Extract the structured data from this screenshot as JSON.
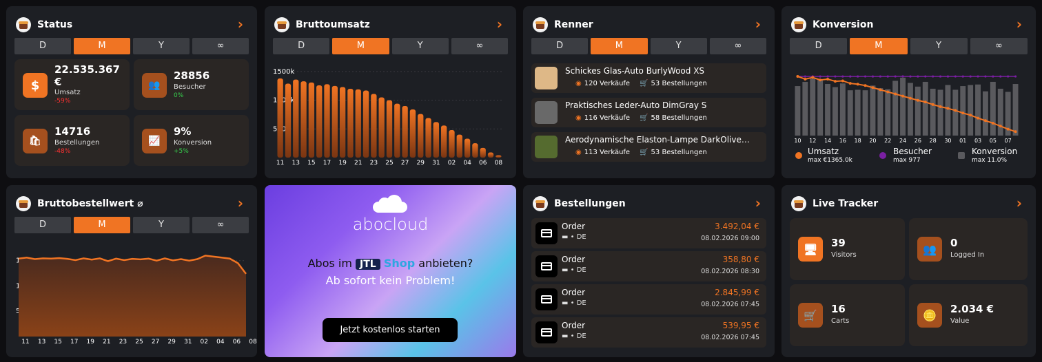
{
  "segments": [
    "D",
    "M",
    "Y",
    "∞"
  ],
  "accent": "#f07423",
  "status": {
    "title": "Status",
    "tiles": [
      {
        "icon": "dollar-icon",
        "glyph": "$",
        "value": "22.535.367",
        "value2": "€",
        "label": "Umsatz",
        "change": "-59%",
        "trend": "neg"
      },
      {
        "icon": "users-icon",
        "glyph": "👥",
        "value": "28856",
        "label": "Besucher",
        "change": "0%",
        "trend": "pos"
      },
      {
        "icon": "bag-icon",
        "glyph": "🛍",
        "value": "14716",
        "label": "Bestellungen",
        "change": "-48%",
        "trend": "neg"
      },
      {
        "icon": "conversion-icon",
        "glyph": "📈",
        "value": "9%",
        "label": "Konversion",
        "change": "+5%",
        "trend": "pos"
      }
    ]
  },
  "brutto": {
    "title": "Bruttoumsatz",
    "chart_data": {
      "type": "bar",
      "categories": [
        "11",
        "12",
        "13",
        "14",
        "15",
        "16",
        "17",
        "18",
        "19",
        "20",
        "21",
        "22",
        "23",
        "24",
        "25",
        "26",
        "27",
        "28",
        "29",
        "30",
        "31",
        "01",
        "02",
        "03",
        "04",
        "05",
        "06",
        "07",
        "08"
      ],
      "values": [
        1380,
        1290,
        1360,
        1330,
        1310,
        1260,
        1280,
        1250,
        1230,
        1200,
        1190,
        1170,
        1110,
        1050,
        1000,
        940,
        900,
        840,
        760,
        690,
        620,
        560,
        480,
        400,
        330,
        250,
        170,
        90,
        40
      ],
      "x_tick_labels": [
        "11",
        "13",
        "15",
        "17",
        "19",
        "21",
        "23",
        "25",
        "27",
        "29",
        "31",
        "02",
        "04",
        "06",
        "08"
      ],
      "y_tick_labels": [
        "500k",
        "1000k",
        "1500k"
      ],
      "ylim": [
        0,
        1500
      ]
    }
  },
  "renner": {
    "title": "Renner",
    "items": [
      {
        "name": "Schickes Glas-Auto BurlyWood XS",
        "sales": "120 Verkäufe",
        "orders": "53 Bestellungen",
        "color": "#deb887"
      },
      {
        "name": "Praktisches Leder-Auto DimGray S",
        "sales": "116 Verkäufe",
        "orders": "58 Bestellungen",
        "color": "#696969"
      },
      {
        "name": "Aerodynamische Elaston-Lampe DarkOlive…",
        "sales": "113 Verkäufe",
        "orders": "53 Bestellungen",
        "color": "#556b2f"
      }
    ]
  },
  "konversion": {
    "title": "Konversion",
    "chart_data": {
      "type": "bar",
      "categories": [
        "10",
        "11",
        "12",
        "13",
        "14",
        "15",
        "16",
        "17",
        "18",
        "19",
        "20",
        "21",
        "22",
        "23",
        "24",
        "25",
        "26",
        "27",
        "28",
        "29",
        "30",
        "31",
        "01",
        "02",
        "03",
        "04",
        "05",
        "06",
        "07",
        "08"
      ],
      "x_tick_labels": [
        "10",
        "12",
        "14",
        "16",
        "18",
        "20",
        "22",
        "24",
        "26",
        "28",
        "30",
        "01",
        "03",
        "05",
        "07"
      ],
      "series": [
        {
          "name": "Umsatz",
          "sub": "max €1365.0k",
          "color": "#f07423",
          "values": [
            1365,
            1300,
            1340,
            1280,
            1300,
            1250,
            1260,
            1200,
            1180,
            1150,
            1100,
            1050,
            1000,
            950,
            900,
            850,
            800,
            760,
            700,
            650,
            610,
            560,
            500,
            450,
            380,
            320,
            260,
            190,
            120,
            60
          ]
        },
        {
          "name": "Besucher",
          "sub": "max 977",
          "color": "#7a1fa2",
          "values": [
            950,
            940,
            960,
            930,
            950,
            955,
            945,
            930,
            940,
            950,
            945,
            935,
            940,
            950,
            960,
            945,
            940,
            950,
            955,
            940,
            945,
            950,
            940,
            945,
            950,
            955,
            940,
            945,
            950,
            955
          ]
        },
        {
          "name": "Konversion",
          "sub": "max 11.0%",
          "color": "#5a5a5e",
          "values": [
            9.4,
            10.2,
            10.8,
            10.6,
            9.8,
            9.2,
            9.9,
            8.6,
            8.7,
            8.6,
            9.5,
            9.0,
            8.8,
            10.4,
            11.0,
            10.0,
            9.3,
            10.2,
            8.9,
            8.7,
            9.6,
            8.7,
            9.4,
            9.6,
            9.7,
            8.4,
            10.2,
            8.9,
            8.3,
            9.8
          ]
        }
      ]
    }
  },
  "bbw": {
    "title": "Bruttobestellwert ⌀",
    "chart_data": {
      "type": "area",
      "categories": [
        "11",
        "12",
        "13",
        "14",
        "15",
        "16",
        "17",
        "18",
        "19",
        "20",
        "21",
        "22",
        "23",
        "24",
        "25",
        "26",
        "27",
        "28",
        "29",
        "30",
        "31",
        "01",
        "02",
        "03",
        "04",
        "05",
        "06",
        "07",
        "08"
      ],
      "values": [
        1540,
        1560,
        1530,
        1545,
        1540,
        1550,
        1535,
        1510,
        1545,
        1520,
        1545,
        1490,
        1540,
        1510,
        1535,
        1525,
        1540,
        1500,
        1545,
        1505,
        1530,
        1500,
        1530,
        1600,
        1580,
        1560,
        1540,
        1450,
        1240
      ],
      "x_tick_labels": [
        "11",
        "13",
        "15",
        "17",
        "19",
        "21",
        "23",
        "25",
        "27",
        "29",
        "31",
        "02",
        "04",
        "06",
        "08"
      ],
      "y_tick_labels": [
        "500",
        "1.0k",
        "1.5k"
      ],
      "ylim": [
        0,
        1700
      ]
    }
  },
  "ad": {
    "brand": "abocloud",
    "line1_pre": "Abos im",
    "logo_a": "JTL",
    "logo_b": "Shop",
    "line1_post": "anbieten?",
    "line2": "Ab sofort kein Problem!",
    "cta": "Jetzt kostenlos starten"
  },
  "bestellungen": {
    "title": "Bestellungen",
    "orders": [
      {
        "name": "Order",
        "country": "• DE",
        "amount": "3.492,04 €",
        "date": "08.02.2026 09:00"
      },
      {
        "name": "Order",
        "country": "• DE",
        "amount": "358,80 €",
        "date": "08.02.2026 08:30"
      },
      {
        "name": "Order",
        "country": "• DE",
        "amount": "2.845,99 €",
        "date": "08.02.2026 07:45"
      },
      {
        "name": "Order",
        "country": "• DE",
        "amount": "539,95 €",
        "date": "08.02.2026 07:45"
      }
    ]
  },
  "live": {
    "title": "Live Tracker",
    "tiles": [
      {
        "icon": "screen-icon",
        "glyph": "🖥",
        "value": "39",
        "label": "Visitors"
      },
      {
        "icon": "users-icon",
        "glyph": "👥",
        "value": "0",
        "label": "Logged In"
      },
      {
        "icon": "cart-icon",
        "glyph": "🛒",
        "value": "16",
        "label": "Carts"
      },
      {
        "icon": "coins-icon",
        "glyph": "🪙",
        "value": "2.034 €",
        "label": "Value"
      }
    ]
  }
}
